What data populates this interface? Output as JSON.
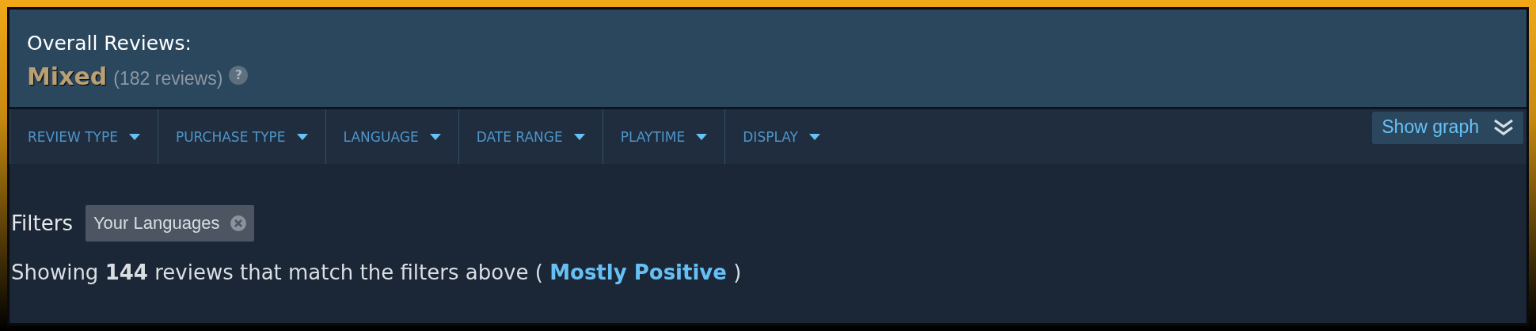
{
  "overall": {
    "label": "Overall Reviews:",
    "rating": "Mixed",
    "count": "(182 reviews)",
    "help": "?"
  },
  "filter_menus": [
    {
      "label": "REVIEW TYPE"
    },
    {
      "label": "PURCHASE TYPE"
    },
    {
      "label": "LANGUAGE"
    },
    {
      "label": "DATE RANGE"
    },
    {
      "label": "PLAYTIME"
    },
    {
      "label": "DISPLAY"
    }
  ],
  "show_graph": {
    "label": "Show graph",
    "expanded": false
  },
  "filters": {
    "label": "Filters",
    "chips": [
      {
        "label": "Your Languages"
      }
    ]
  },
  "summary": {
    "text": "Showing **144** reviews that match the filters above (",
    "link": "Mostly Positive",
    "end": ")"
  }
}
